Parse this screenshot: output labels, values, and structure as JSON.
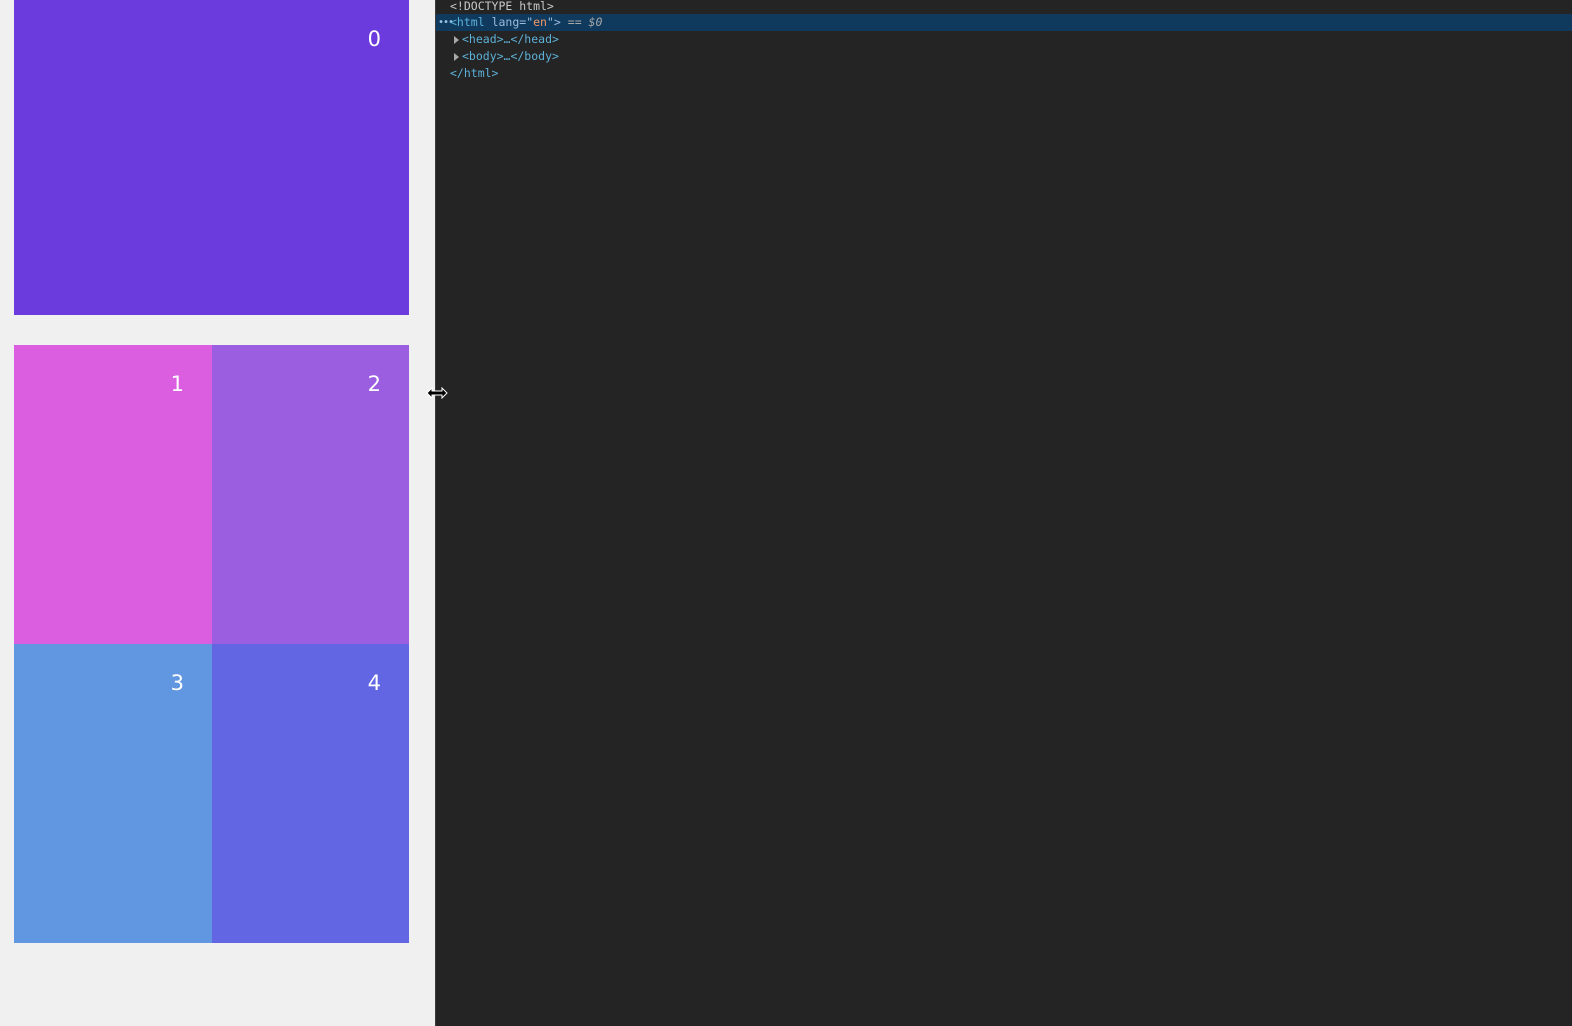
{
  "boxes": [
    {
      "label": "0",
      "color": "#6b3bde"
    },
    {
      "label": "1",
      "color": "#db5ee1"
    },
    {
      "label": "2",
      "color": "#9c5ee1"
    },
    {
      "label": "3",
      "color": "#6197e0"
    },
    {
      "label": "4",
      "color": "#6266e3"
    }
  ],
  "devtools": {
    "doctype": "<!DOCTYPE html>",
    "html_open_tag": "<html",
    "html_attr_name": "lang",
    "html_attr_eq": "=\"",
    "html_attr_value": "en",
    "html_attr_close": "\">",
    "selected_marker": "== $0",
    "head_node": "<head>…</head>",
    "body_node": "<body>…</body>",
    "html_close": "</html>"
  },
  "colors": {
    "page_background": "#f0f0f0",
    "devtools_background": "#242424",
    "selected_row": "#0f3a5e"
  },
  "icons": {
    "cursor": "horizontal-resize-cursor-icon",
    "expand": "expand-triangle-icon",
    "more": "ellipsis-icon"
  }
}
